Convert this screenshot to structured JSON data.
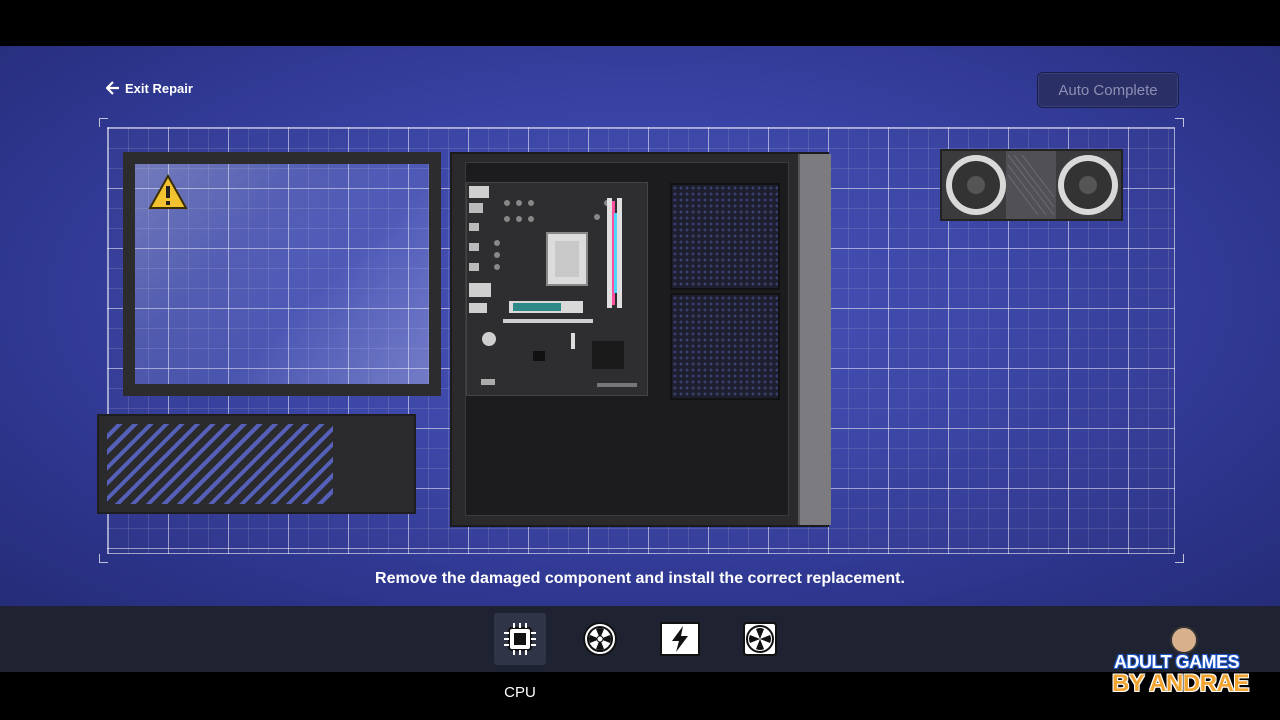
{
  "header": {
    "exit_label": "Exit Repair",
    "auto_complete_label": "Auto Complete"
  },
  "instruction": "Remove the damaged component and install the correct replacement.",
  "toolbar": {
    "items": [
      {
        "label": "CPU",
        "icon": "cpu-icon",
        "active": true
      },
      {
        "label": "",
        "icon": "cpu-fan-icon",
        "active": false
      },
      {
        "label": "",
        "icon": "power-icon",
        "active": false
      },
      {
        "label": "",
        "icon": "case-fan-icon",
        "active": false
      }
    ],
    "active_label": "CPU"
  },
  "watermark": {
    "line1": "ADULT GAMES",
    "line2": "BY ANDRAE"
  },
  "colors": {
    "accent": "#3a44a6",
    "warning": "#f2c230"
  }
}
